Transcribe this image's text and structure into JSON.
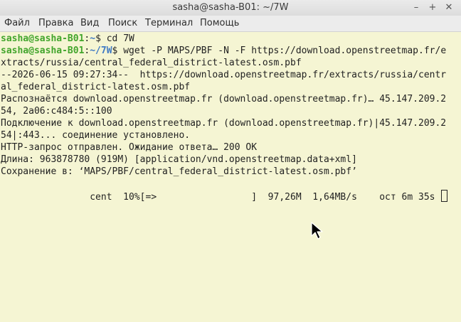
{
  "window": {
    "title": "sasha@sasha-B01: ~/7W",
    "minimize_glyph": "–",
    "maximize_glyph": "+",
    "close_glyph": "✕"
  },
  "menu": {
    "items": [
      "Файл",
      "Правка",
      "Вид",
      "Поиск",
      "Терминал",
      "Помощь"
    ]
  },
  "terminal": {
    "prompt_user": "sasha@sasha-B01",
    "prompt1_path": "~",
    "prompt1_cmd": "$ cd 7W",
    "prompt2_path": "~/7W",
    "prompt2_cmd": "$ wget -P MAPS/PBF -N -F https://download.openstreetmap.fr/e",
    "lines": [
      "xtracts/russia/central_federal_district-latest.osm.pbf",
      "--2026-06-15 09:27:34--  https://download.openstreetmap.fr/extracts/russia/centr",
      "al_federal_district-latest.osm.pbf",
      "Распознаётся download.openstreetmap.fr (download.openstreetmap.fr)… 45.147.209.2",
      "54, 2a06:c484:5::100",
      "Подключение к download.openstreetmap.fr (download.openstreetmap.fr)|45.147.209.2",
      "54|:443... соединение установлено.",
      "HTTP-запрос отправлен. Ожидание ответа… 200 OK",
      "Длина: 963878780 (919M) [application/vnd.openstreetmap.data+xml]",
      "Сохранение в: ‘MAPS/PBF/central_federal_district-latest.osm.pbf’",
      "",
      "                cent  10%[=>                 ]  97,26M  1,64MB/s    ост 6m 35s "
    ]
  },
  "colors": {
    "background": "#f5f5d3",
    "prompt_user": "#42a52c",
    "prompt_path": "#3e79c4"
  }
}
